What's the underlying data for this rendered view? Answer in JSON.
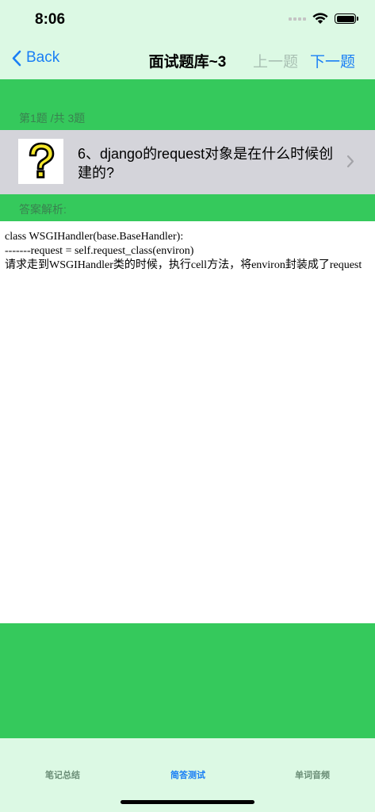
{
  "status_bar": {
    "time": "8:06"
  },
  "nav": {
    "back_label": "Back",
    "title": "面试题库~3",
    "prev_label": "上一题",
    "next_label": "下一题"
  },
  "question": {
    "counter": "第1题 /共 3题",
    "text": "6、django的request对象是在什么时候创建的?"
  },
  "answer": {
    "label": "答案解析:",
    "lines": [
      "class WSGIHandler(base.BaseHandler):",
      "-------request = self.request_class(environ)",
      "请求走到WSGIHandler类的时候，执行cell方法，将environ封装成了request"
    ]
  },
  "tabs": [
    {
      "label": "笔记总结",
      "active": false
    },
    {
      "label": "简答测试",
      "active": true
    },
    {
      "label": "单词音频",
      "active": false
    }
  ],
  "colors": {
    "accent": "#1a7ff5",
    "green": "#35c95c",
    "bar_bg": "#dcf9e4"
  }
}
